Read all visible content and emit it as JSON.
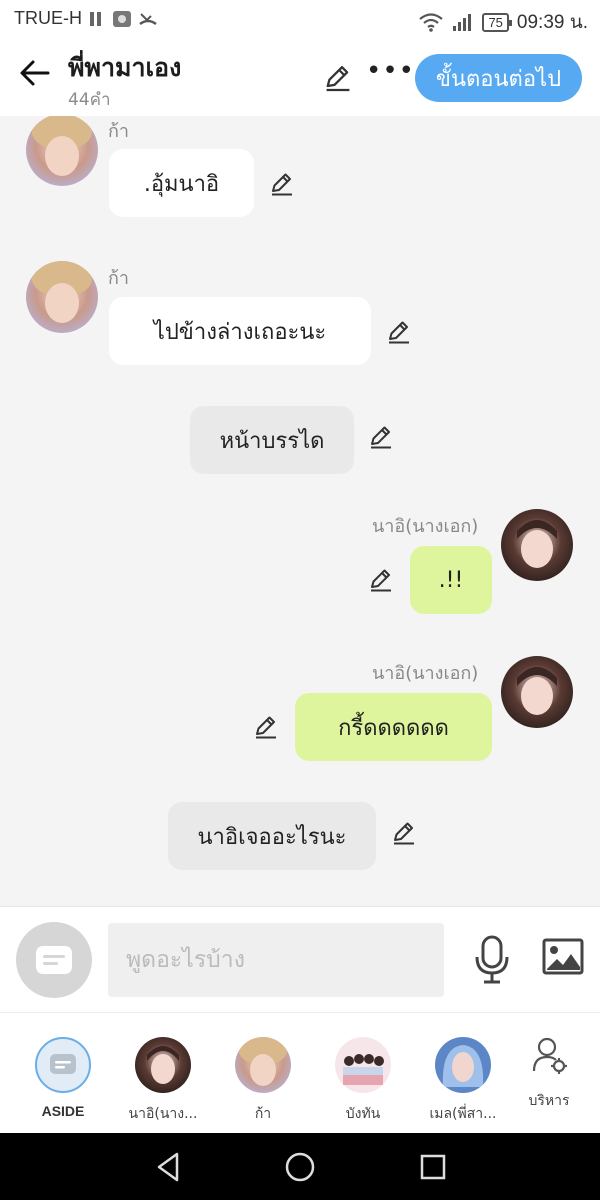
{
  "status_bar": {
    "carrier": "TRUE-H",
    "battery": "75",
    "time": "09:39 น."
  },
  "header": {
    "title": "พี่พามาเอง",
    "word_count": "44คำ",
    "next_label": "ขั้นตอนต่อไป"
  },
  "messages": [
    {
      "type": "left",
      "sender": "ก้า",
      "text": ".อุ้มนาอิ"
    },
    {
      "type": "left",
      "sender": "ก้า",
      "text": "ไปข้างล่างเถอะนะ"
    },
    {
      "type": "narration",
      "text": "หน้าบรรได"
    },
    {
      "type": "right",
      "sender": "นาอิ(นางเอก)",
      "text": ".!!"
    },
    {
      "type": "right",
      "sender": "นาอิ(นางเอก)",
      "text": "กรี้ดดดดดด"
    },
    {
      "type": "narration",
      "text": "นาอิเจออะไรนะ"
    }
  ],
  "input": {
    "placeholder": "พูดอะไรบ้าง"
  },
  "characters": [
    {
      "name": "ASIDE"
    },
    {
      "name": "นาอิ(นาง..."
    },
    {
      "name": "ก้า"
    },
    {
      "name": "บังทัน"
    },
    {
      "name": "เมล(พี่สา..."
    },
    {
      "name": "บริหาร"
    }
  ],
  "colors": {
    "accent": "#57aaf2",
    "right_bubble": "#dff59d",
    "narration_bubble": "#e9e9e9"
  }
}
